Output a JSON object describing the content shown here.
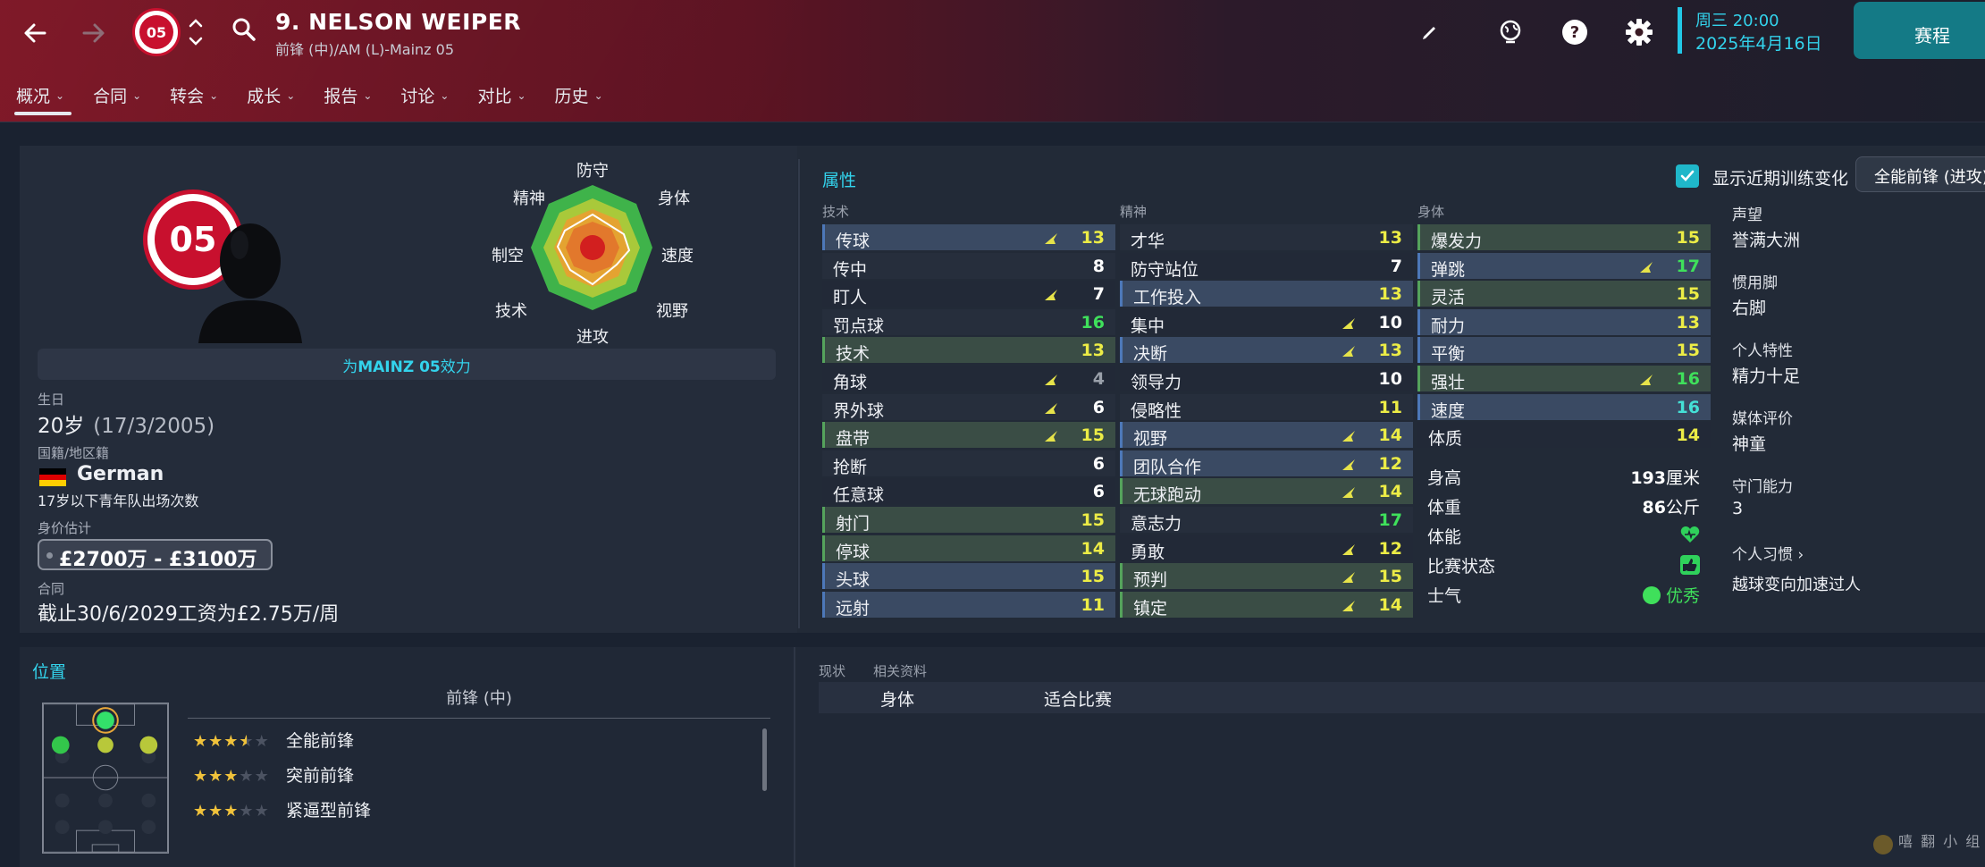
{
  "header": {
    "player_name": "9. NELSON WEIPER",
    "player_subtitle": "前锋 (中)/AM (L)-Mainz 05",
    "club_badge_text": "05",
    "date_day": "周三 20:00",
    "date_full": "2025年4月16日",
    "continue_label": "赛程"
  },
  "tabs": [
    {
      "label": "概况"
    },
    {
      "label": "合同"
    },
    {
      "label": "转会"
    },
    {
      "label": "成长"
    },
    {
      "label": "报告"
    },
    {
      "label": "讨论"
    },
    {
      "label": "对比"
    },
    {
      "label": "历史"
    }
  ],
  "radar": {
    "labels": [
      "防守",
      "身体",
      "速度",
      "视野",
      "进攻",
      "技术",
      "制空",
      "精神"
    ]
  },
  "info": {
    "club_prefix": "为",
    "club_name": "MAINZ 05",
    "club_suffix": "效力",
    "birth_label": "生日",
    "age": "20岁",
    "birth_date": "(17/3/2005)",
    "nationality_label": "国籍/地区籍",
    "nationality": "German",
    "youth_caps": "17岁以下青年队出场次数",
    "value_label": "身价估计",
    "value": "£2700万 - £3100万",
    "contract_label": "合同",
    "contract": "截止30/6/2029工资为£2.75万/周"
  },
  "attributes": {
    "title": "属性",
    "show_changes_label": "显示近期训练变化",
    "show_changes_checked": true,
    "role_select": "全能前锋 (进攻)",
    "technical_title": "技术",
    "mental_title": "精神",
    "physical_title": "身体",
    "technical": [
      {
        "name": "传球",
        "value": "13",
        "style": "key-blue",
        "color": "y",
        "arrow": true
      },
      {
        "name": "传中",
        "value": "8",
        "style": "plain",
        "color": "w",
        "arrow": false
      },
      {
        "name": "盯人",
        "value": "7",
        "style": "alt",
        "color": "w",
        "arrow": true
      },
      {
        "name": "罚点球",
        "value": "16",
        "style": "plain",
        "color": "gr",
        "arrow": false
      },
      {
        "name": "技术",
        "value": "13",
        "style": "key-green",
        "color": "y",
        "arrow": false
      },
      {
        "name": "角球",
        "value": "4",
        "style": "alt",
        "color": "g",
        "arrow": true
      },
      {
        "name": "界外球",
        "value": "6",
        "style": "plain",
        "color": "w",
        "arrow": true
      },
      {
        "name": "盘带",
        "value": "15",
        "style": "key-green",
        "color": "y",
        "arrow": true
      },
      {
        "name": "抢断",
        "value": "6",
        "style": "plain",
        "color": "w",
        "arrow": false
      },
      {
        "name": "任意球",
        "value": "6",
        "style": "alt",
        "color": "w",
        "arrow": false
      },
      {
        "name": "射门",
        "value": "15",
        "style": "key-green",
        "color": "y",
        "arrow": false
      },
      {
        "name": "停球",
        "value": "14",
        "style": "key-green",
        "color": "y",
        "arrow": false
      },
      {
        "name": "头球",
        "value": "15",
        "style": "key-blue",
        "color": "y",
        "arrow": false
      },
      {
        "name": "远射",
        "value": "11",
        "style": "key-blue",
        "color": "y",
        "arrow": false
      }
    ],
    "mental": [
      {
        "name": "才华",
        "value": "13",
        "style": "plain",
        "color": "y",
        "arrow": false
      },
      {
        "name": "防守站位",
        "value": "7",
        "style": "alt",
        "color": "w",
        "arrow": false
      },
      {
        "name": "工作投入",
        "value": "13",
        "style": "key-blue",
        "color": "y",
        "arrow": false
      },
      {
        "name": "集中",
        "value": "10",
        "style": "alt",
        "color": "w",
        "arrow": true
      },
      {
        "name": "决断",
        "value": "13",
        "style": "key-blue",
        "color": "y",
        "arrow": true
      },
      {
        "name": "领导力",
        "value": "10",
        "style": "alt",
        "color": "w",
        "arrow": false
      },
      {
        "name": "侵略性",
        "value": "11",
        "style": "plain",
        "color": "y",
        "arrow": false
      },
      {
        "name": "视野",
        "value": "14",
        "style": "key-blue",
        "color": "y",
        "arrow": true
      },
      {
        "name": "团队合作",
        "value": "12",
        "style": "key-blue",
        "color": "y",
        "arrow": true
      },
      {
        "name": "无球跑动",
        "value": "14",
        "style": "key-green",
        "color": "y",
        "arrow": true
      },
      {
        "name": "意志力",
        "value": "17",
        "style": "plain",
        "color": "gr",
        "arrow": false
      },
      {
        "name": "勇敢",
        "value": "12",
        "style": "alt",
        "color": "y",
        "arrow": true
      },
      {
        "name": "预判",
        "value": "15",
        "style": "key-green",
        "color": "y",
        "arrow": true
      },
      {
        "name": "镇定",
        "value": "14",
        "style": "key-green",
        "color": "y",
        "arrow": true
      }
    ],
    "physical": [
      {
        "name": "爆发力",
        "value": "15",
        "style": "key-green",
        "color": "y",
        "arrow": false
      },
      {
        "name": "弹跳",
        "value": "17",
        "style": "key-blue",
        "color": "gr",
        "arrow": true
      },
      {
        "name": "灵活",
        "value": "15",
        "style": "key-green",
        "color": "y",
        "arrow": false
      },
      {
        "name": "耐力",
        "value": "13",
        "style": "key-blue",
        "color": "y",
        "arrow": false
      },
      {
        "name": "平衡",
        "value": "15",
        "style": "key-blue",
        "color": "y",
        "arrow": false
      },
      {
        "name": "强壮",
        "value": "16",
        "style": "key-green",
        "color": "gr",
        "arrow": true
      },
      {
        "name": "速度",
        "value": "16",
        "style": "key-blue",
        "color": "cy",
        "arrow": false
      },
      {
        "name": "体质",
        "value": "14",
        "style": "alt",
        "color": "y",
        "arrow": false
      }
    ],
    "height_label": "身高",
    "height_num": "193",
    "height_unit": "厘米",
    "weight_label": "体重",
    "weight_num": "86",
    "weight_unit": "公斤",
    "fitness_label": "体能",
    "form_label": "比赛状态",
    "morale_label": "士气",
    "morale_value": "优秀"
  },
  "side": {
    "reputation_label": "声望",
    "reputation": "誉满大洲",
    "foot_label": "惯用脚",
    "foot": "右脚",
    "personality_label": "个人特性",
    "personality": "精力十足",
    "media_label": "媒体评价",
    "media": "神童",
    "gk_label": "守门能力",
    "gk": "3",
    "habits_label": "个人习惯",
    "habit": "越球变向加速过人"
  },
  "position": {
    "title": "位置",
    "header": "前锋 (中)",
    "roles": [
      {
        "name": "全能前锋",
        "stars": 3.5
      },
      {
        "name": "突前前锋",
        "stars": 3
      },
      {
        "name": "紧逼型前锋",
        "stars": 3
      }
    ]
  },
  "status": {
    "tab1": "现状",
    "tab2": "相关资料",
    "col1": "身体",
    "col2": "适合比赛"
  },
  "watermark": "嘻 翻 小 组"
}
